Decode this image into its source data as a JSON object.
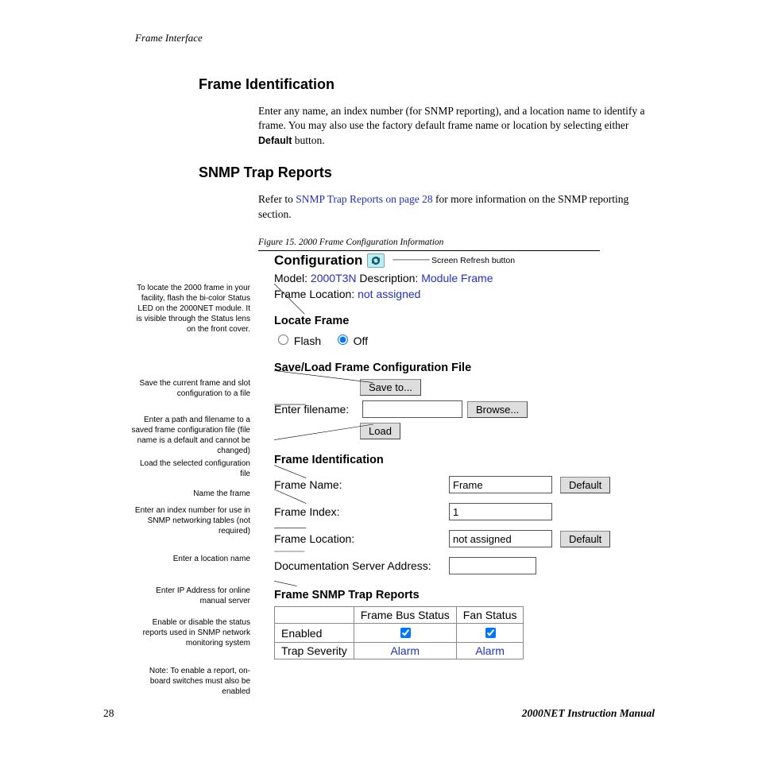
{
  "header": "Frame Interface",
  "sections": {
    "frame_id": {
      "title": "Frame Identification",
      "body_pre": "Enter any name, an index number (for SNMP reporting), and a location name to identify a frame. You may also use the factory default frame name or location by selecting either ",
      "body_bold": "Default",
      "body_post": " button."
    },
    "snmp": {
      "title": "SNMP Trap Reports",
      "body_pre": "Refer to ",
      "xref": "SNMP Trap Reports on page 28",
      "body_post": " for more information on the SNMP reporting section."
    }
  },
  "figure": {
    "caption": "Figure 15.  2000 Frame Configuration Information",
    "refresh_label": "Screen Refresh button",
    "config_title": "Configuration",
    "model_label": "Model:",
    "model_value": "2000T3N",
    "desc_label": "Description:",
    "desc_value": "Module Frame",
    "frame_loc_label": "Frame Location:",
    "frame_loc_value": "not assigned",
    "locate_title": "Locate Frame",
    "radio_flash": "Flash",
    "radio_off": "Off",
    "saveload_title": "Save/Load Frame Configuration File",
    "btn_saveto": "Save to...",
    "enter_filename": "Enter filename:",
    "btn_browse": "Browse...",
    "btn_load": "Load",
    "frameid_title": "Frame Identification",
    "fname_label": "Frame Name:",
    "fname_value": "Frame",
    "btn_default": "Default",
    "findex_label": "Frame Index:",
    "findex_value": "1",
    "floc_label": "Frame Location:",
    "floc_value": "not assigned",
    "docsrv_label": "Documentation Server Address:",
    "snmp_title": "Frame SNMP Trap Reports",
    "th_bus": "Frame Bus Status",
    "th_fan": "Fan Status",
    "row_enabled": "Enabled",
    "row_trap": "Trap Severity",
    "alarm": "Alarm",
    "annot": {
      "locate": "To locate the 2000 frame in your facility, flash the bi-color Status LED on the 2000NET module. It is visible through the Status lens on the front cover.",
      "save": "Save the current frame and slot configuration to a file",
      "filename": "Enter a path and filename to a saved frame configuration file (file name is a default and cannot be changed)",
      "load": "Load the selected configuration file",
      "name": "Name the frame",
      "index": "Enter an index number for use in SNMP networking tables (not required)",
      "location": "Enter a location name",
      "docsrv": "Enter IP Address for online manual server",
      "snmp": "Enable or disable the status reports used in SNMP network monitoring  system",
      "note": "Note: To enable a report, on-board switches must also be enabled"
    }
  },
  "footer": {
    "page": "28",
    "manual": "2000NET Instruction Manual"
  }
}
